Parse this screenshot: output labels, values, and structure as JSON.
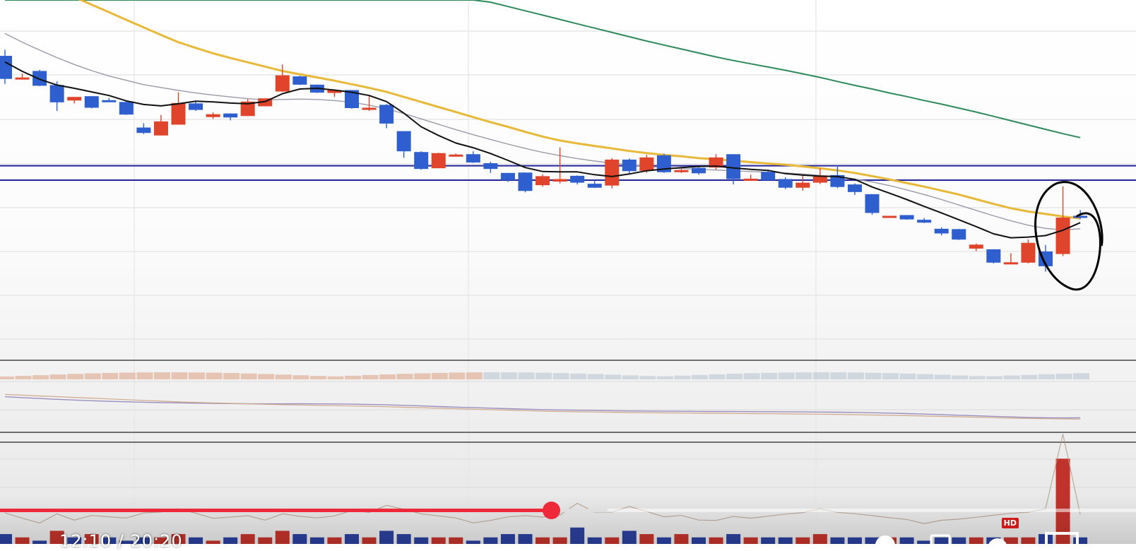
{
  "chart_data": {
    "type": "candlestick",
    "ylim": [
      0,
      100
    ],
    "candles": [
      {
        "o": 84.5,
        "h": 86.2,
        "l": 76.7,
        "c": 78.1,
        "dir": "down"
      },
      {
        "o": 78.3,
        "h": 79.6,
        "l": 77.9,
        "c": 78.5,
        "dir": "up"
      },
      {
        "o": 80.3,
        "h": 80.6,
        "l": 76.1,
        "c": 76.2,
        "dir": "down"
      },
      {
        "o": 76.4,
        "h": 77.4,
        "l": 69.2,
        "c": 71.6,
        "dir": "down"
      },
      {
        "o": 72.1,
        "h": 72.6,
        "l": 71.3,
        "c": 73.1,
        "dir": "up"
      },
      {
        "o": 73.3,
        "h": 73.3,
        "l": 69.9,
        "c": 70.1,
        "dir": "down"
      },
      {
        "o": 72.2,
        "h": 72.8,
        "l": 71.8,
        "c": 72.0,
        "dir": "down"
      },
      {
        "o": 71.7,
        "h": 72.0,
        "l": 68.1,
        "c": 68.2,
        "dir": "down"
      },
      {
        "o": 64.6,
        "h": 65.8,
        "l": 62.8,
        "c": 63.1,
        "dir": "down"
      },
      {
        "o": 62.4,
        "h": 68.1,
        "l": 62.4,
        "c": 66.3,
        "dir": "up"
      },
      {
        "o": 65.4,
        "h": 74.4,
        "l": 65.4,
        "c": 71.4,
        "dir": "up"
      },
      {
        "o": 71.3,
        "h": 72.0,
        "l": 69.2,
        "c": 69.5,
        "dir": "down"
      },
      {
        "o": 67.5,
        "h": 68.8,
        "l": 67.0,
        "c": 68.3,
        "dir": "up"
      },
      {
        "o": 68.5,
        "h": 68.5,
        "l": 66.6,
        "c": 67.4,
        "dir": "down"
      },
      {
        "o": 67.8,
        "h": 72.5,
        "l": 67.8,
        "c": 71.8,
        "dir": "up"
      },
      {
        "o": 70.5,
        "h": 72.7,
        "l": 70.5,
        "c": 72.7,
        "dir": "up"
      },
      {
        "o": 74.6,
        "h": 82.1,
        "l": 74.5,
        "c": 79.1,
        "dir": "up"
      },
      {
        "o": 78.8,
        "h": 79.0,
        "l": 76.4,
        "c": 76.5,
        "dir": "down"
      },
      {
        "o": 76.5,
        "h": 76.5,
        "l": 74.2,
        "c": 74.3,
        "dir": "down"
      },
      {
        "o": 75.0,
        "h": 75.1,
        "l": 73.1,
        "c": 74.2,
        "dir": "up"
      },
      {
        "o": 75.0,
        "h": 75.0,
        "l": 69.8,
        "c": 70.0,
        "dir": "down"
      },
      {
        "o": 70.1,
        "h": 73.4,
        "l": 69.2,
        "c": 69.5,
        "dir": "up"
      },
      {
        "o": 70.9,
        "h": 71.1,
        "l": 64.4,
        "c": 65.7,
        "dir": "down"
      },
      {
        "o": 63.6,
        "h": 63.6,
        "l": 56.2,
        "c": 58.0,
        "dir": "down"
      },
      {
        "o": 57.8,
        "h": 58.0,
        "l": 52.9,
        "c": 53.1,
        "dir": "down"
      },
      {
        "o": 53.3,
        "h": 57.6,
        "l": 53.3,
        "c": 57.5,
        "dir": "up"
      },
      {
        "o": 57.1,
        "h": 57.4,
        "l": 56.7,
        "c": 57.0,
        "dir": "up"
      },
      {
        "o": 57.2,
        "h": 58.0,
        "l": 54.8,
        "c": 54.9,
        "dir": "down"
      },
      {
        "o": 54.7,
        "h": 55.1,
        "l": 52.0,
        "c": 53.1,
        "dir": "down"
      },
      {
        "o": 52.0,
        "h": 52.0,
        "l": 49.5,
        "c": 50.0,
        "dir": "down"
      },
      {
        "o": 52.1,
        "h": 52.1,
        "l": 46.6,
        "c": 47.0,
        "dir": "down"
      },
      {
        "o": 48.6,
        "h": 51.6,
        "l": 48.2,
        "c": 51.1,
        "dir": "up"
      },
      {
        "o": 49.6,
        "h": 59.1,
        "l": 49.1,
        "c": 50.3,
        "dir": "up"
      },
      {
        "o": 51.2,
        "h": 51.3,
        "l": 48.8,
        "c": 49.3,
        "dir": "down"
      },
      {
        "o": 49.0,
        "h": 50.1,
        "l": 47.8,
        "c": 47.9,
        "dir": "down"
      },
      {
        "o": 48.5,
        "h": 56.1,
        "l": 47.7,
        "c": 55.7,
        "dir": "up"
      },
      {
        "o": 55.7,
        "h": 56.0,
        "l": 51.9,
        "c": 52.5,
        "dir": "down"
      },
      {
        "o": 52.6,
        "h": 57.0,
        "l": 52.0,
        "c": 56.3,
        "dir": "up"
      },
      {
        "o": 56.9,
        "h": 57.3,
        "l": 52.0,
        "c": 52.2,
        "dir": "down"
      },
      {
        "o": 52.5,
        "h": 53.1,
        "l": 52.0,
        "c": 52.8,
        "dir": "up"
      },
      {
        "o": 53.4,
        "h": 53.7,
        "l": 51.5,
        "c": 51.9,
        "dir": "down"
      },
      {
        "o": 53.5,
        "h": 57.2,
        "l": 52.9,
        "c": 56.3,
        "dir": "up"
      },
      {
        "o": 57.2,
        "h": 57.2,
        "l": 48.8,
        "c": 50.3,
        "dir": "down"
      },
      {
        "o": 49.8,
        "h": 51.5,
        "l": 49.8,
        "c": 50.4,
        "dir": "up"
      },
      {
        "o": 52.3,
        "h": 52.8,
        "l": 49.9,
        "c": 50.0,
        "dir": "down"
      },
      {
        "o": 50.3,
        "h": 50.8,
        "l": 47.5,
        "c": 47.9,
        "dir": "down"
      },
      {
        "o": 47.9,
        "h": 51.5,
        "l": 47.1,
        "c": 49.3,
        "dir": "up"
      },
      {
        "o": 49.3,
        "h": 53.3,
        "l": 48.9,
        "c": 51.3,
        "dir": "up"
      },
      {
        "o": 51.4,
        "h": 54.2,
        "l": 47.8,
        "c": 48.1,
        "dir": "down"
      },
      {
        "o": 48.8,
        "h": 49.1,
        "l": 45.9,
        "c": 46.7,
        "dir": "down"
      },
      {
        "o": 46.1,
        "h": 46.1,
        "l": 40.4,
        "c": 40.9,
        "dir": "down"
      },
      {
        "o": 40.1,
        "h": 40.1,
        "l": 39.5,
        "c": 39.7,
        "dir": "up"
      },
      {
        "o": 40.3,
        "h": 40.3,
        "l": 39.0,
        "c": 39.1,
        "dir": "down"
      },
      {
        "o": 39.0,
        "h": 39.5,
        "l": 38.1,
        "c": 38.2,
        "dir": "down"
      },
      {
        "o": 36.5,
        "h": 36.9,
        "l": 34.7,
        "c": 35.2,
        "dir": "down"
      },
      {
        "o": 36.4,
        "h": 36.5,
        "l": 33.4,
        "c": 33.5,
        "dir": "down"
      },
      {
        "o": 32.1,
        "h": 32.4,
        "l": 30.3,
        "c": 31.0,
        "dir": "up"
      },
      {
        "o": 30.8,
        "h": 30.8,
        "l": 26.9,
        "c": 27.1,
        "dir": "down"
      },
      {
        "o": 27.2,
        "h": 29.7,
        "l": 26.8,
        "c": 27.2,
        "dir": "up"
      },
      {
        "o": 27.1,
        "h": 33.5,
        "l": 26.9,
        "c": 32.6,
        "dir": "up"
      },
      {
        "o": 30.2,
        "h": 32.0,
        "l": 24.6,
        "c": 26.1,
        "dir": "down"
      },
      {
        "o": 29.5,
        "h": 48.3,
        "l": 28.9,
        "c": 39.6,
        "dir": "up"
      },
      {
        "o": 40.1,
        "h": 41.7,
        "l": 39.2,
        "c": 39.6,
        "dir": "down"
      }
    ],
    "ma_fast": [
      82.8,
      80.2,
      78.0,
      76.4,
      75.5,
      74.5,
      73.5,
      72.0,
      71.0,
      70.6,
      71.2,
      71.9,
      71.7,
      71.4,
      71.2,
      71.8,
      74.0,
      75.3,
      75.5,
      75.0,
      74.4,
      73.5,
      71.8,
      68.6,
      64.8,
      62.4,
      60.3,
      59.0,
      57.4,
      55.5,
      53.5,
      52.4,
      52.3,
      52.3,
      51.5,
      51.0,
      51.7,
      52.6,
      53.1,
      53.5,
      53.8,
      53.9,
      53.4,
      53.0,
      52.7,
      51.8,
      51.4,
      51.1,
      51.0,
      50.2,
      48.1,
      46.4,
      44.6,
      42.7,
      40.9,
      39.0,
      37.1,
      35.1,
      34.0,
      34.2,
      34.6,
      36.1,
      38.2
    ],
    "ma_mid": [
      90.7,
      88.3,
      86.1,
      84.0,
      82.1,
      80.4,
      78.9,
      77.7,
      76.5,
      75.7,
      74.9,
      74.2,
      73.6,
      73.1,
      72.6,
      72.3,
      72.4,
      72.5,
      72.4,
      72.1,
      71.6,
      70.8,
      69.8,
      68.5,
      67.0,
      65.5,
      64.0,
      62.6,
      61.3,
      60.0,
      58.8,
      57.7,
      56.8,
      56.0,
      55.3,
      54.7,
      54.2,
      53.8,
      53.5,
      53.2,
      53.0,
      52.8,
      52.6,
      52.4,
      52.2,
      52.0,
      51.7,
      51.3,
      50.9,
      50.3,
      49.5,
      48.5,
      47.3,
      46.0,
      44.6,
      43.1,
      41.6,
      40.1,
      38.7,
      37.5,
      36.6,
      36.2,
      36.5
    ],
    "ma_slow": [
      109.4,
      107.2,
      105.0,
      102.9,
      100.8,
      98.7,
      96.6,
      94.5,
      92.4,
      90.3,
      88.3,
      86.7,
      85.2,
      83.9,
      82.7,
      81.5,
      80.3,
      79.4,
      78.5,
      77.6,
      76.6,
      75.6,
      74.5,
      73.1,
      71.7,
      70.3,
      68.9,
      67.5,
      66.1,
      64.8,
      63.4,
      62.1,
      61.0,
      60.2,
      59.5,
      58.8,
      58.1,
      57.5,
      57.0,
      56.6,
      56.1,
      55.8,
      55.4,
      55.0,
      54.6,
      54.3,
      53.8,
      53.3,
      52.7,
      52.0,
      51.1,
      50.2,
      49.2,
      48.2,
      47.1,
      46.0,
      44.7,
      43.4,
      42.2,
      41.3,
      40.6,
      39.9,
      39.4
    ],
    "ma_long": [
      100.0,
      100.0,
      100.0,
      100.0,
      100.0,
      100.0,
      100.0,
      100.0,
      100.0,
      100.0,
      100.0,
      100.0,
      100.0,
      100.0,
      100.0,
      100.0,
      100.0,
      100.0,
      100.0,
      100.0,
      100.0,
      100.0,
      100.0,
      100.0,
      100.0,
      100.0,
      100.0,
      100.0,
      99.4,
      98.2,
      97.0,
      95.8,
      94.6,
      93.4,
      92.2,
      91.0,
      89.8,
      88.6,
      87.5,
      86.4,
      85.3,
      84.2,
      83.2,
      82.3,
      81.4,
      80.5,
      79.5,
      78.5,
      77.4,
      76.3,
      75.3,
      74.2,
      73.2,
      72.1,
      71.1,
      70.0,
      68.9,
      67.7,
      66.5,
      65.3,
      64.1,
      62.9,
      61.8
    ],
    "h_levels": [
      54.0,
      50.0
    ],
    "volume": [
      3,
      2,
      1,
      4,
      2,
      3,
      2,
      1,
      2,
      2,
      3,
      2,
      1,
      2,
      3,
      2,
      4,
      3,
      2,
      2,
      3,
      2,
      4,
      3,
      2,
      2,
      2,
      1,
      2,
      3,
      3,
      2,
      2,
      5,
      2,
      2,
      4,
      3,
      2,
      3,
      2,
      2,
      3,
      2,
      2,
      2,
      2,
      3,
      2,
      2,
      2,
      2,
      2,
      1,
      2,
      2,
      2,
      2,
      2,
      2,
      3,
      26,
      2
    ],
    "volume_max": 28,
    "volume_dir": [
      "down",
      "up",
      "down",
      "up",
      "down",
      "up",
      "down",
      "down",
      "down",
      "up",
      "up",
      "down",
      "up",
      "down",
      "up",
      "up",
      "up",
      "down",
      "down",
      "up",
      "down",
      "up",
      "down",
      "down",
      "down",
      "up",
      "up",
      "down",
      "down",
      "down",
      "down",
      "up",
      "up",
      "down",
      "down",
      "up",
      "down",
      "up",
      "down",
      "up",
      "down",
      "up",
      "down",
      "up",
      "down",
      "down",
      "up",
      "up",
      "down",
      "down",
      "down",
      "up",
      "down",
      "down",
      "down",
      "down",
      "up",
      "down",
      "up",
      "up",
      "down",
      "up",
      "down"
    ],
    "colors": {
      "up": "#e0442a",
      "down": "#2f5fcf",
      "ma_fast": "#111111",
      "ma_mid": "#9a9aa8",
      "ma_slow": "#e8b838",
      "ma_long": "#2e8a5a",
      "h_level": "#24249a",
      "annotation": "#000000"
    }
  },
  "player": {
    "time_text": "12:10 / 20:20",
    "hd_label": "HD",
    "progress_played": 0.485,
    "progress_buffered": 0.535
  }
}
